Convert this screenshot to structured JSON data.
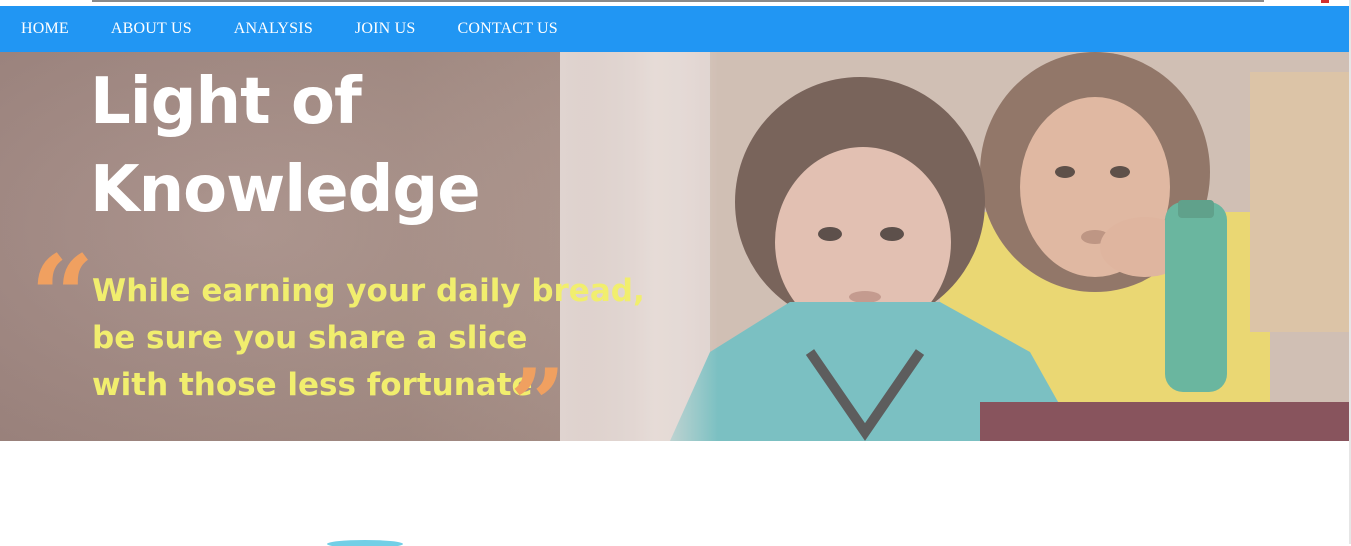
{
  "nav": {
    "items": [
      {
        "label": "HOME"
      },
      {
        "label": "ABOUT US"
      },
      {
        "label": "ANALYSIS"
      },
      {
        "label": "JOIN US"
      },
      {
        "label": "CONTACT US"
      }
    ]
  },
  "hero": {
    "title_line1": "Light of",
    "title_line2": "Knowledge",
    "quote_open_mark": "“",
    "quote_close_mark": "”",
    "quote_lines": [
      "While earning your daily bread,",
      "be sure you share a slice",
      "with those less fortunate"
    ]
  },
  "colors": {
    "nav_bg": "#2196f3",
    "nav_text": "#ffffff",
    "quote_text": "#f1ee6e",
    "quote_marks": "#f0a060",
    "title_text": "#ffffff"
  },
  "icons": {
    "hero_image": "children-photo-icon",
    "bottom_logo": "logo-icon"
  }
}
